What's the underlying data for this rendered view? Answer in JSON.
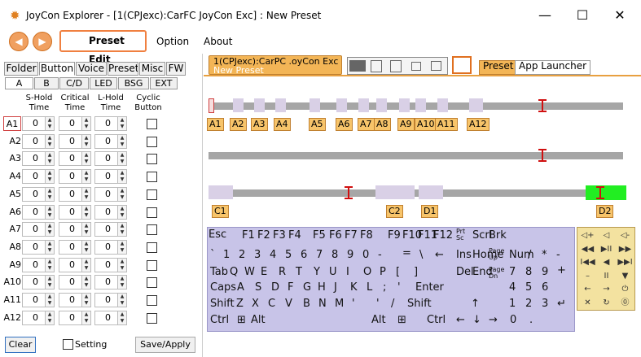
{
  "window": {
    "title": "JoyCon Explorer - [1(CPJexc):CarFC JoyCon Exc] : New Preset",
    "minimize": "—",
    "maximize": "☐",
    "close": "✕"
  },
  "toolbar": {
    "back": "◀",
    "forward": "▶",
    "preset_edit": "Preset Edit",
    "menu": [
      "Option",
      "About"
    ]
  },
  "left": {
    "tabs": [
      "Folder",
      "Button",
      "Voice",
      "Preset",
      "Misc",
      "FW"
    ],
    "subtabs": [
      "A",
      "B",
      "C/D",
      "LED",
      "BSG",
      "EXT"
    ],
    "columns": [
      "S-Hold\nTime",
      "Critical\nTime",
      "L-Hold\nTime",
      "Cyclic\nButton"
    ],
    "rows": [
      {
        "label": "A1",
        "s": "0",
        "c": "0",
        "l": "0"
      },
      {
        "label": "A2",
        "s": "0",
        "c": "0",
        "l": "0"
      },
      {
        "label": "A3",
        "s": "0",
        "c": "0",
        "l": "0"
      },
      {
        "label": "A4",
        "s": "0",
        "c": "0",
        "l": "0"
      },
      {
        "label": "A5",
        "s": "0",
        "c": "0",
        "l": "0"
      },
      {
        "label": "A6",
        "s": "0",
        "c": "0",
        "l": "0"
      },
      {
        "label": "A7",
        "s": "0",
        "c": "0",
        "l": "0"
      },
      {
        "label": "A8",
        "s": "0",
        "c": "0",
        "l": "0"
      },
      {
        "label": "A9",
        "s": "0",
        "c": "0",
        "l": "0"
      },
      {
        "label": "A10",
        "s": "0",
        "c": "0",
        "l": "0"
      },
      {
        "label": "A11",
        "s": "0",
        "c": "0",
        "l": "0"
      },
      {
        "label": "A12",
        "s": "0",
        "c": "0",
        "l": "0"
      }
    ],
    "clear": "Clear",
    "setting": "Setting",
    "save": "Save/Apply"
  },
  "right": {
    "device_tab": "1(CPJexc):CarPC .oyCon Exc",
    "device_sub": "New Preset",
    "tabs": [
      "Preset",
      "App Launcher"
    ],
    "a_labels": [
      "A1",
      "A2",
      "A3",
      "A4",
      "A5",
      "A6",
      "A7",
      "A8",
      "A9",
      "A10",
      "A11",
      "A12"
    ],
    "cd_labels": [
      "C1",
      "C2",
      "D1",
      "D2"
    ]
  },
  "keyboard": {
    "row1": [
      "Esc",
      "F1",
      "F2",
      "F3",
      "F4",
      "F5",
      "F6",
      "F7",
      "F8",
      "F9",
      "F10",
      "F11",
      "F12",
      "Prt Sc",
      "Scrl",
      "Brk"
    ],
    "row2": [
      "`",
      "1",
      "2",
      "3",
      "4",
      "5",
      "6",
      "7",
      "8",
      "9",
      "0",
      "-",
      "=",
      "\\",
      "←",
      "Ins",
      "Home",
      "Page Up",
      "Num",
      "/",
      "*",
      "-"
    ],
    "row3": [
      "Tab",
      "Q",
      "W",
      "E",
      "R",
      "T",
      "Y",
      "U",
      "I",
      "O",
      "P",
      "[",
      "]",
      "Del",
      "End",
      "Page Dn",
      "7",
      "8",
      "9",
      "+"
    ],
    "row4": [
      "Caps",
      "A",
      "S",
      "D",
      "F",
      "G",
      "H",
      "J",
      "K",
      "L",
      ";",
      "'",
      "Enter",
      "4",
      "5",
      "6"
    ],
    "row5": [
      "Shift",
      "Z",
      "X",
      "C",
      "V",
      "B",
      "N",
      "M",
      "'",
      "'",
      "/",
      "Shift",
      "↑",
      "1",
      "2",
      "3",
      "↵"
    ],
    "row6": [
      "Ctrl",
      "⊞",
      "Alt",
      "Alt",
      "⊞",
      "Ctrl",
      "←",
      "↓",
      "→",
      "0",
      "."
    ]
  },
  "mediapad": [
    "◁+",
    "◁",
    "◁-",
    "◀◀",
    "▶II",
    "▶▶",
    "I◀◀",
    "◀",
    "▶▶I",
    "–",
    "II",
    "▼",
    "←",
    "→",
    "⏻",
    "✕",
    "↻",
    "⓪"
  ]
}
